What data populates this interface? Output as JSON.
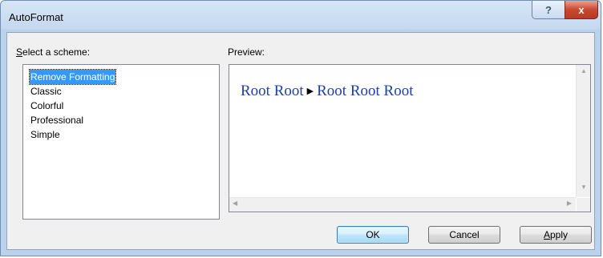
{
  "window": {
    "title": "AutoFormat",
    "help_glyph": "?",
    "close_glyph": "x"
  },
  "scheme": {
    "label_accel": "S",
    "label_rest": "elect a scheme:",
    "items": [
      {
        "label": "Remove Formatting",
        "selected": true
      },
      {
        "label": "Classic",
        "selected": false
      },
      {
        "label": "Colorful",
        "selected": false
      },
      {
        "label": "Professional",
        "selected": false
      },
      {
        "label": "Simple",
        "selected": false
      }
    ]
  },
  "preview": {
    "label": "Preview:",
    "crumb_before": "Root Root",
    "crumb_after": "Root Root Root",
    "crumb_color": "#1f3fa8"
  },
  "buttons": {
    "ok": "OK",
    "cancel": "Cancel",
    "apply_accel": "A",
    "apply_rest": "pply"
  },
  "colors": {
    "selection": "#3399ff",
    "close_button": "#c8492f"
  },
  "icons": {
    "help": "question-mark",
    "close": "x-mark",
    "crumb_separator": "triangle-right",
    "scroll_up": "arrow-up",
    "scroll_down": "arrow-down",
    "scroll_left": "arrow-left",
    "scroll_right": "arrow-right"
  }
}
